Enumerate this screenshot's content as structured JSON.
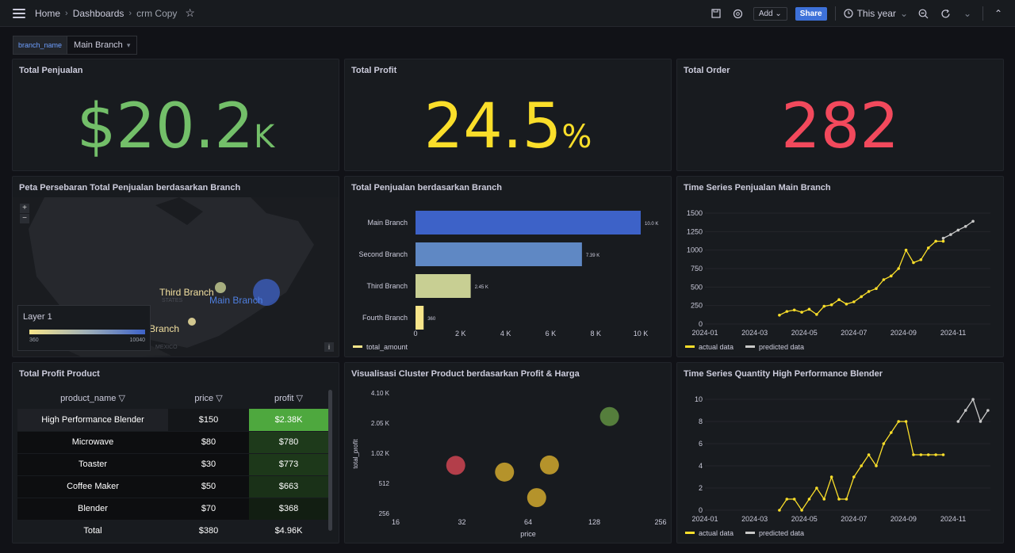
{
  "topbar": {
    "crumbs": [
      "Home",
      "Dashboards",
      "crm Copy"
    ],
    "add_label": "Add",
    "share_label": "Share",
    "time_range": "This year"
  },
  "variable": {
    "name": "branch_name",
    "value": "Main Branch"
  },
  "panels": {
    "total_penjualan": {
      "title": "Total Penjualan",
      "prefix": "$",
      "value": "20.2",
      "unit": "K",
      "color": "#73bf69"
    },
    "total_profit": {
      "title": "Total Profit",
      "value": "24.5",
      "unit": "%",
      "color": "#fade2a"
    },
    "total_order": {
      "title": "Total Order",
      "value": "282",
      "color": "#f2495c"
    },
    "map": {
      "title": "Peta Persebaran Total Penjualan berdasarkan Branch",
      "zoom_in": "+",
      "zoom_out": "−",
      "labels": [
        "Third Branch",
        "Main Branch",
        "h Branch",
        "STATES",
        "MEXICO"
      ],
      "legend_title": "Layer 1",
      "legend_min": "360",
      "legend_max": "10040",
      "info": "i"
    },
    "bar": {
      "title": "Total Penjualan berdasarkan Branch",
      "legend": "total_amount"
    },
    "ts1": {
      "title": "Time Series Penjualan Main Branch",
      "legend_actual": "actual data",
      "legend_predicted": "predicted data"
    },
    "table": {
      "title": "Total Profit Product",
      "headers": [
        "product_name",
        "price",
        "profit"
      ],
      "rows": [
        {
          "name": "High Performance Blender",
          "price": "$150",
          "profit": "$2.38K"
        },
        {
          "name": "Microwave",
          "price": "$80",
          "profit": "$780"
        },
        {
          "name": "Toaster",
          "price": "$30",
          "profit": "$773"
        },
        {
          "name": "Coffee Maker",
          "price": "$50",
          "profit": "$663"
        },
        {
          "name": "Blender",
          "price": "$70",
          "profit": "$368"
        }
      ],
      "total": {
        "label": "Total",
        "price": "$380",
        "profit": "$4.96K"
      }
    },
    "scatter": {
      "title": "Visualisasi Cluster Product berdasarkan Profit & Harga"
    },
    "ts2": {
      "title": "Time Series Quantity High Performance Blender",
      "legend_actual": "actual data",
      "legend_predicted": "predicted data"
    }
  },
  "chart_data": [
    {
      "type": "bar",
      "orientation": "horizontal",
      "categories": [
        "Main Branch",
        "Second Branch",
        "Third Branch",
        "Fourth Branch"
      ],
      "values": [
        10000,
        7390,
        2450,
        360
      ],
      "value_labels": [
        "10.0 K",
        "7.39 K",
        "2.45 K",
        "360"
      ],
      "xticks": [
        "0",
        "2 K",
        "4 K",
        "6 K",
        "8 K",
        "10 K"
      ],
      "xlim": [
        0,
        10000
      ],
      "colors": [
        "#3d62c8",
        "#5f88c4",
        "#c8cf93",
        "#f7e58a"
      ],
      "legend": "total_amount"
    },
    {
      "type": "line",
      "xticks": [
        "2024-01",
        "2024-03",
        "2024-05",
        "2024-07",
        "2024-09",
        "2024-11"
      ],
      "yticks": [
        "0",
        "250",
        "500",
        "750",
        "1000",
        "1250",
        "1500"
      ],
      "ylim": [
        0,
        1500
      ],
      "series": [
        {
          "name": "actual data",
          "color": "#fade2a",
          "x": [
            4.0,
            4.3,
            4.6,
            4.9,
            5.2,
            5.5,
            5.8,
            6.1,
            6.4,
            6.7,
            7.0,
            7.3,
            7.6,
            7.9,
            8.2,
            8.5,
            8.8,
            9.1,
            9.4,
            9.7,
            10.0,
            10.3,
            10.6
          ],
          "y": [
            120,
            170,
            190,
            160,
            200,
            130,
            240,
            260,
            330,
            270,
            300,
            370,
            440,
            480,
            600,
            650,
            750,
            1000,
            830,
            870,
            1030,
            1120,
            1120
          ]
        },
        {
          "name": "predicted data",
          "color": "#c8c8c8",
          "x": [
            10.6,
            10.9,
            11.2,
            11.5,
            11.8
          ],
          "y": [
            1160,
            1210,
            1270,
            1320,
            1390
          ]
        }
      ]
    },
    {
      "type": "scatter",
      "xlabel": "price",
      "ylabel": "total_profit",
      "x_scale": "log2",
      "y_scale": "log2",
      "xticks": [
        "16",
        "32",
        "64",
        "128",
        "256"
      ],
      "yticks": [
        "256",
        "512",
        "1.02 K",
        "2.05 K",
        "4.10 K"
      ],
      "points": [
        {
          "x": 30,
          "y": 773,
          "color": "#c4424f"
        },
        {
          "x": 50,
          "y": 663,
          "color": "#c7a12c"
        },
        {
          "x": 70,
          "y": 368,
          "color": "#c7a12c"
        },
        {
          "x": 80,
          "y": 780,
          "color": "#c7a12c"
        },
        {
          "x": 150,
          "y": 2380,
          "color": "#5c8a3f"
        }
      ]
    },
    {
      "type": "line",
      "xticks": [
        "2024-01",
        "2024-03",
        "2024-05",
        "2024-07",
        "2024-09",
        "2024-11"
      ],
      "yticks": [
        "0",
        "2",
        "4",
        "6",
        "8",
        "10"
      ],
      "ylim": [
        0,
        10
      ],
      "series": [
        {
          "name": "actual data",
          "color": "#fade2a",
          "x": [
            4.0,
            4.3,
            4.6,
            4.9,
            5.2,
            5.5,
            5.8,
            6.1,
            6.4,
            6.7,
            7.0,
            7.3,
            7.6,
            7.9,
            8.2,
            8.5,
            8.8,
            9.1,
            9.4,
            9.7,
            10.0,
            10.3,
            10.6
          ],
          "y": [
            0,
            1,
            1,
            0,
            1,
            2,
            1,
            3,
            1,
            1,
            3,
            4,
            5,
            4,
            6,
            7,
            8,
            8,
            5,
            5,
            5,
            5,
            5
          ]
        },
        {
          "name": "predicted data",
          "color": "#c8c8c8",
          "x": [
            11.2,
            11.5,
            11.8,
            12.1,
            12.4
          ],
          "y": [
            8,
            9,
            10,
            8,
            9
          ]
        }
      ]
    }
  ]
}
